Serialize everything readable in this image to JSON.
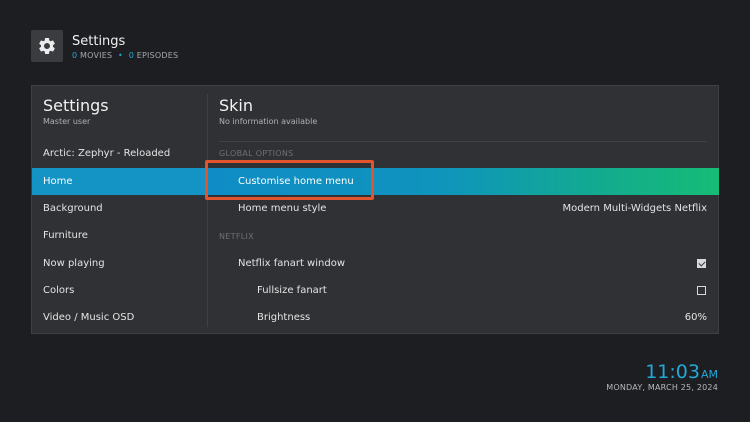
{
  "header": {
    "icon": "gear-icon",
    "title": "Settings",
    "movies_count": "0",
    "movies_label": "MOVIES",
    "separator": "•",
    "episodes_count": "0",
    "episodes_label": "EPISODES"
  },
  "left": {
    "title": "Settings",
    "subtitle": "Master user",
    "items": [
      {
        "label": "Arctic: Zephyr - Reloaded"
      },
      {
        "label": "Home"
      },
      {
        "label": "Background"
      },
      {
        "label": "Furniture"
      },
      {
        "label": "Now playing"
      },
      {
        "label": "Colors"
      },
      {
        "label": "Video / Music OSD"
      }
    ],
    "selected_index": 1
  },
  "right": {
    "title": "Skin",
    "subtitle": "No information available",
    "section_global": "GLOBAL OPTIONS",
    "section_netflix": "NETFLIX",
    "items": [
      {
        "label": "Customise home menu",
        "value": ""
      },
      {
        "label": "Home menu style",
        "value": "Modern Multi-Widgets Netflix"
      },
      {
        "label": "Netflix fanart window",
        "checked": true
      },
      {
        "label": "Fullsize fanart",
        "checked": false
      },
      {
        "label": "Brightness",
        "value": "60%"
      }
    ]
  },
  "clock": {
    "time": "11:03",
    "ampm": "AM",
    "date": "MONDAY, MARCH 25, 2024"
  },
  "colors": {
    "accent": "#24a8d8",
    "highlight_border": "#e2542d",
    "selection_start": "#0f8cc6",
    "selection_end": "#16bc76",
    "panel_bg": "#2f3134",
    "page_bg": "#1c1e22"
  }
}
